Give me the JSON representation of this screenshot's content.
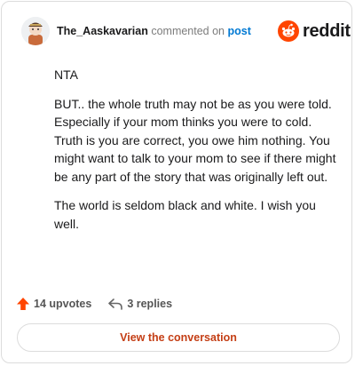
{
  "header": {
    "username": "The_Aaskavarian",
    "action_text": "commented on",
    "post_link": "post"
  },
  "logo": {
    "text": "reddit",
    "icon": "reddit-snoo-icon",
    "color": "#ff4500"
  },
  "comment": {
    "paragraphs": [
      "NTA",
      "BUT.. the whole truth may not be as you were told. Especially if your mom thinks you were to cold. Truth is you are correct, you owe him nothing. You might want to talk to your mom to see if there might be any part of the story that was originally left out.",
      "The world is seldom black and white. I wish you well."
    ]
  },
  "footer": {
    "upvotes": "14 upvotes",
    "upvote_icon": "upvote-arrow-icon",
    "upvote_color": "#ff4500",
    "replies": "3 replies",
    "reply_icon": "reply-arrow-icon"
  },
  "cta": {
    "label": "View the conversation",
    "color": "#c43e15"
  }
}
